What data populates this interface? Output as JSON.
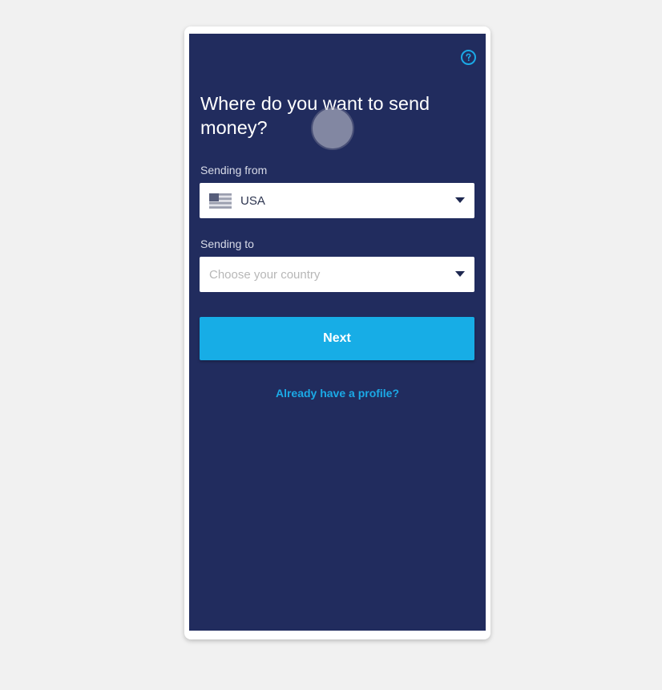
{
  "screen": {
    "heading": "Where do you want to send money?",
    "help_icon": "help-circle-icon"
  },
  "sending_from": {
    "label": "Sending from",
    "value": "USA",
    "flag_icon": "us-flag-icon"
  },
  "sending_to": {
    "label": "Sending to",
    "placeholder": "Choose your country"
  },
  "actions": {
    "next_label": "Next",
    "profile_link": "Already have a profile?"
  },
  "colors": {
    "screen_background": "#212c5e",
    "accent": "#17ade6",
    "page_background": "#f1f1f1"
  }
}
